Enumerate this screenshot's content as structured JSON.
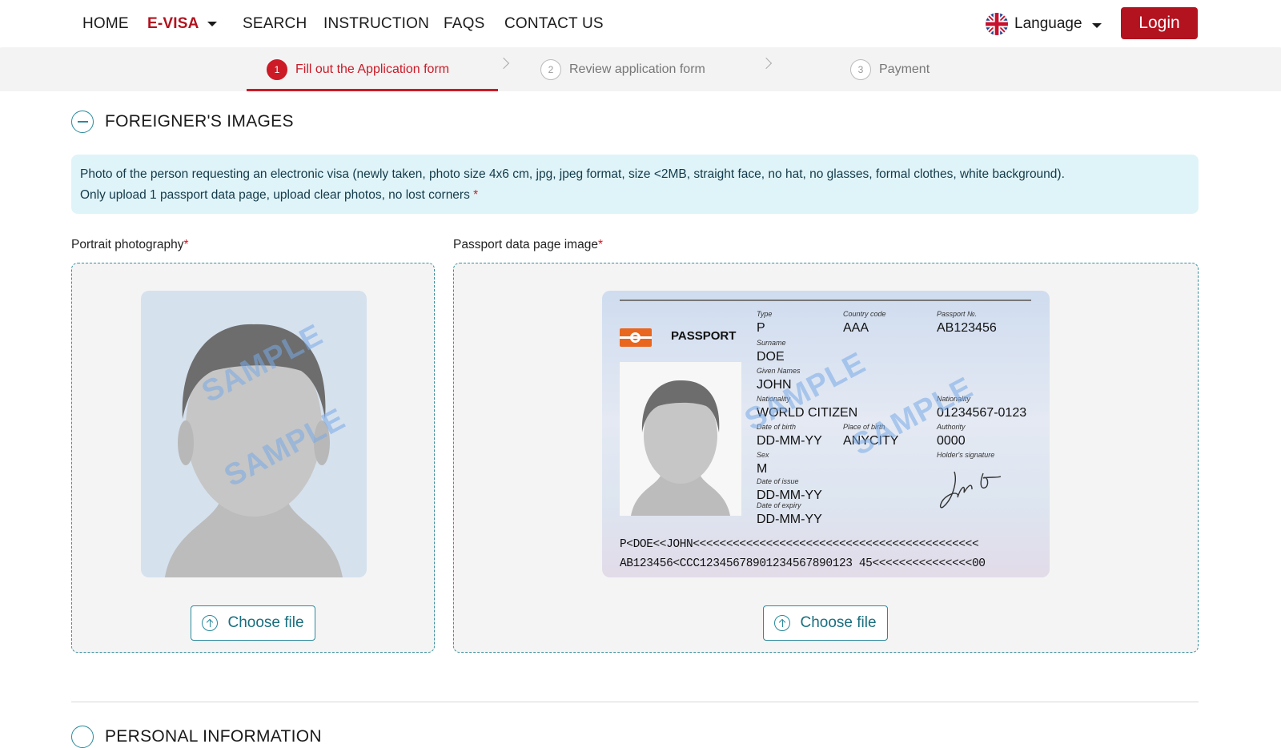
{
  "nav": {
    "items": [
      {
        "label": "HOME"
      },
      {
        "label": "E-VISA"
      },
      {
        "label": "SEARCH"
      },
      {
        "label": "INSTRUCTION"
      },
      {
        "label": "FAQS"
      },
      {
        "label": "CONTACT US"
      }
    ],
    "language_label": "Language",
    "language_flag_icon": "uk-flag-icon",
    "login_label": "Login"
  },
  "stepper": {
    "steps": [
      {
        "number": "1",
        "label": "Fill out the Application form",
        "active": true
      },
      {
        "number": "2",
        "label": "Review application form",
        "active": false
      },
      {
        "number": "3",
        "label": "Payment",
        "active": false
      }
    ]
  },
  "section": {
    "title": "FOREIGNER'S IMAGES",
    "notice_line1": "Photo of the person requesting an electronic visa (newly taken, photo size 4x6 cm, jpg, jpeg format, size <2MB, straight face, no hat, no glasses, formal clothes, white background).",
    "notice_line2": "Only upload 1 passport data page, upload clear photos, no lost corners",
    "required_mark": "*"
  },
  "portrait": {
    "label": "Portrait photography",
    "choose_label": "Choose file",
    "watermark": "SAMPLE"
  },
  "passport": {
    "label": "Passport data page image",
    "choose_label": "Choose file",
    "watermark": "SAMPLE",
    "sample": {
      "heading": "PASSPORT",
      "type_label": "Type",
      "type": "P",
      "country_label": "Country code",
      "country": "AAA",
      "number_label": "Passport №.",
      "number": "AB123456",
      "surname_label": "Surname",
      "surname": "DOE",
      "given_label": "Given Names",
      "given": "JOHN",
      "nationality_label": "Nationality",
      "nationality": "WORLD CITIZEN",
      "personal_no_label": "Nationality",
      "personal_no": "01234567-0123",
      "dob_label": "Date of birth",
      "dob": "DD-MM-YY",
      "pob_label": "Place of birth",
      "pob": "ANYCITY",
      "authority_label": "Authority",
      "authority": "0000",
      "sex_label": "Sex",
      "sex": "M",
      "signature_label": "Holder's signature",
      "issue_label": "Date of issue",
      "issue": "DD-MM-YY",
      "expiry_label": "Date of expiry",
      "expiry": "DD-MM-YY",
      "mrz1": "P<DOE<<JOHN<<<<<<<<<<<<<<<<<<<<<<<<<<<<<<<<<<<<<<<<<<<",
      "mrz2": "AB123456<CCC12345678901234567890123 45<<<<<<<<<<<<<<<00"
    }
  },
  "next_section": {
    "title": "PERSONAL INFORMATION"
  },
  "colors": {
    "brand_red": "#b3121f",
    "accent_teal": "#2a8a9c",
    "notice_bg": "#dff4f8"
  }
}
